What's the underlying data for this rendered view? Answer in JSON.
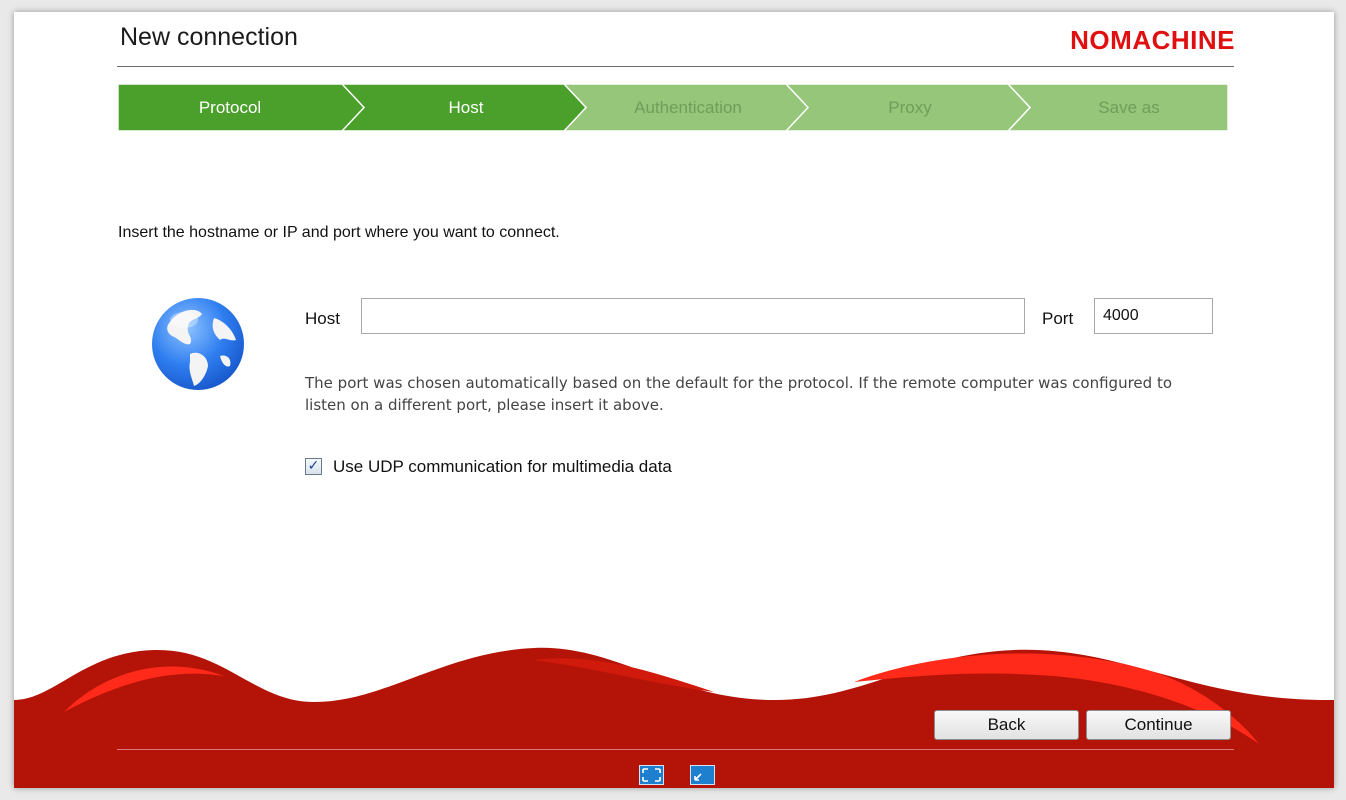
{
  "dialog": {
    "title": "New connection",
    "brand": "NOMACHINE"
  },
  "wizard": {
    "steps": [
      {
        "label": "Protocol",
        "state": "done"
      },
      {
        "label": "Host",
        "state": "current"
      },
      {
        "label": "Authentication",
        "state": "pending"
      },
      {
        "label": "Proxy",
        "state": "pending"
      },
      {
        "label": "Save as",
        "state": "pending"
      }
    ]
  },
  "form": {
    "instruction": "Insert the hostname or IP and port where you want to connect.",
    "host_label": "Host",
    "host_value": "",
    "port_label": "Port",
    "port_value": "4000",
    "note": "The port was chosen automatically based on the default for the protocol. If the remote computer was configured to listen on a different port, please insert it above.",
    "udp_label": "Use UDP communication for multimedia data",
    "udp_checked": true
  },
  "buttons": {
    "back": "Back",
    "continue": "Continue"
  },
  "footer": {
    "icons": [
      "fullscreen-icon",
      "restore-window-icon"
    ]
  },
  "colors": {
    "step_active": "#4aa02a",
    "step_inactive": "#95c67a",
    "step_active_text": "#ffffff",
    "step_inactive_text": "#6f9e5a",
    "wave_red": "#b41408",
    "brand_red": "#e01010"
  },
  "icons": {
    "globe": "globe-icon",
    "checkbox": "checkmark-icon"
  }
}
